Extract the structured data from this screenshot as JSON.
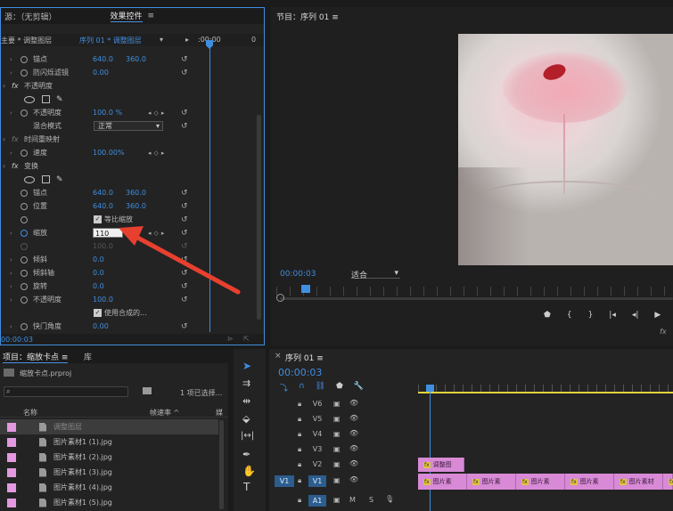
{
  "effects_panel": {
    "tabs": [
      "源：（无剪辑）",
      "效果控件"
    ],
    "menu_glyph": "≡",
    "header_left": "主要 * 调整图层",
    "header_right": "序列 01 * 调整图层",
    "ruler_time": ":00:00",
    "ruler_right": "0",
    "footer_time": "00:00:03",
    "rows": [
      {
        "label": "锚点",
        "v1": "640.0",
        "v2": "360.0"
      },
      {
        "label": "防闪烁滤镜",
        "v1": "0.00"
      },
      {
        "label": "不透明度",
        "group": true
      },
      {
        "label": "不透明度",
        "v1": "100.0 %"
      },
      {
        "label": "混合模式",
        "dropdown": "正常"
      },
      {
        "label": "时间重映射",
        "group": true
      },
      {
        "label": "速度",
        "v1": "100.00%"
      },
      {
        "label": "变换",
        "group": true
      },
      {
        "label": "锚点",
        "v1": "640.0",
        "v2": "360.0"
      },
      {
        "label": "位置",
        "v1": "640.0",
        "v2": "360.0"
      },
      {
        "checkbox": "等比缩放"
      },
      {
        "label": "缩放",
        "input": "110"
      },
      {
        "dim": "100.0"
      },
      {
        "label": "倾斜",
        "v1": "0.0"
      },
      {
        "label": "倾斜轴",
        "v1": "0.0"
      },
      {
        "label": "旋转",
        "v1": "0.0"
      },
      {
        "label": "不透明度",
        "v1": "100.0"
      },
      {
        "checkbox": "使用合成的..."
      },
      {
        "label": "快门角度",
        "v1": "0.00"
      }
    ]
  },
  "program_monitor": {
    "title": "节目：序列 01",
    "menu_glyph": "≡",
    "timecode": "00:00:03",
    "fit": "适合",
    "fx_glyph": "fx"
  },
  "project_panel": {
    "tab": "项目：缩放卡点",
    "menu_glyph": "≡",
    "tab2_glyph": "库",
    "file": "缩放卡点.prproj",
    "selection": "1 项已选择...",
    "col_name": "名称",
    "col_rate": "帧速率 ^",
    "col_extra": "媒",
    "items": [
      "调整图层",
      "图片素材1 (1).jpg",
      "图片素材1 (2).jpg",
      "图片素材1 (3).jpg",
      "图片素材1 (4).jpg",
      "图片素材1 (5).jpg"
    ]
  },
  "timeline": {
    "tab": "序列 01",
    "menu_glyph": "≡",
    "timecode": "00:00:03",
    "tracks": [
      "V6",
      "V5",
      "V4",
      "V3",
      "V2",
      "V1",
      "A1"
    ],
    "src_v1": "V1",
    "src_a1": "A1",
    "adj_clip": "调整图",
    "clip_label": "图片素",
    "clip_label_long": "图片素材",
    "fx": "fx"
  },
  "colors": {
    "accent": "#3f8ee0",
    "clip": "#d88ad6",
    "playhead_line": "#e0d33a",
    "arrow": "#e8402f"
  }
}
